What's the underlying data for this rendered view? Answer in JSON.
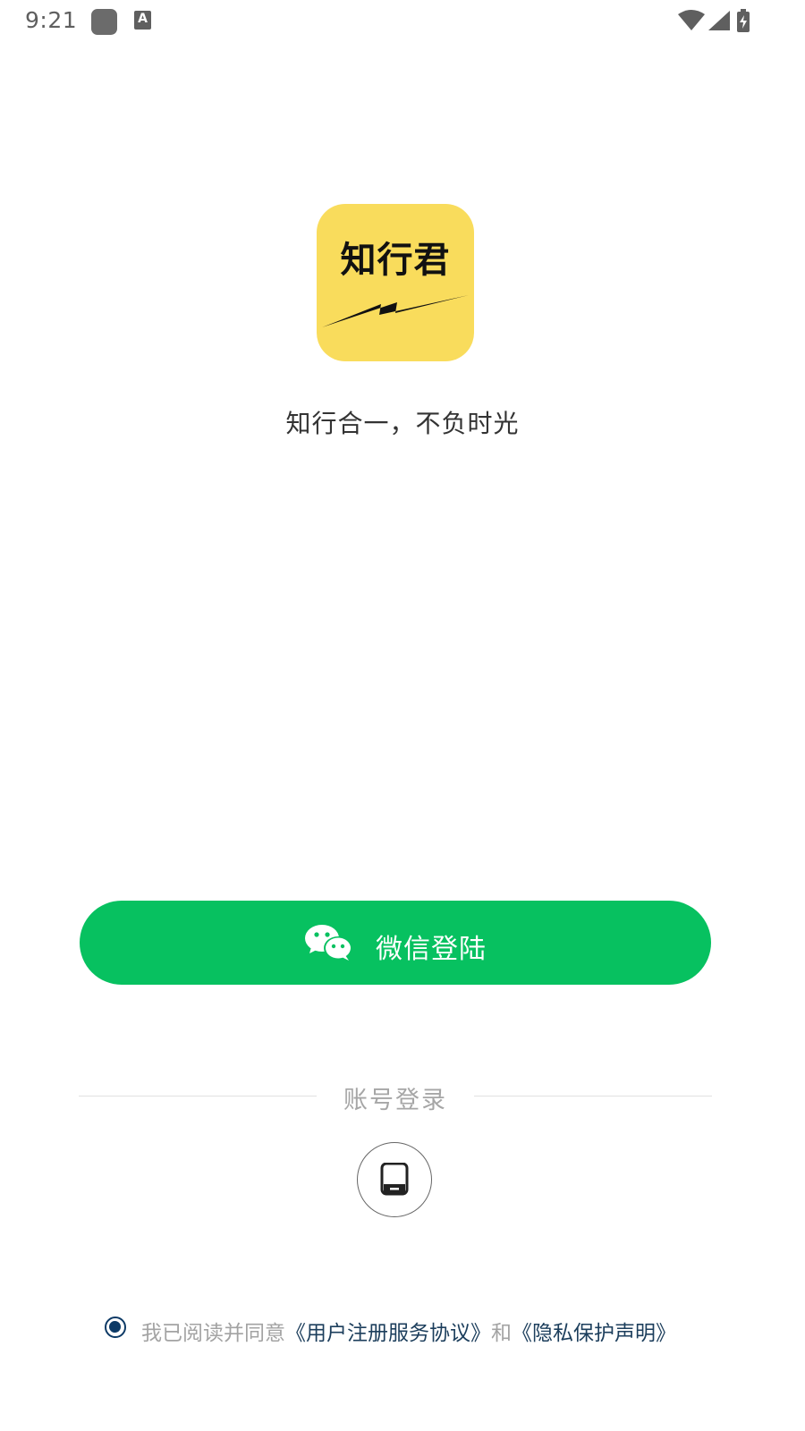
{
  "status_bar": {
    "time": "9:21",
    "a_icon_letter": "A",
    "icons": [
      "app-icon",
      "a-icon",
      "wifi-icon",
      "signal-icon",
      "battery-charging-icon"
    ]
  },
  "logo": {
    "text": "知行君",
    "background_color": "#f9dc5c"
  },
  "slogan": "知行合一，不负时光",
  "wechat_login": {
    "label": "微信登陆",
    "icon": "wechat-icon",
    "color": "#07c160"
  },
  "account_login": {
    "divider_text": "账号登录",
    "phone_icon": "phone-icon"
  },
  "agreement": {
    "checked": true,
    "prefix": "我已阅读并同意",
    "user_agreement": "《用户注册服务协议》",
    "conjunction": "和",
    "privacy_policy": "《隐私保护声明》",
    "link_color": "#1c3e5c"
  }
}
